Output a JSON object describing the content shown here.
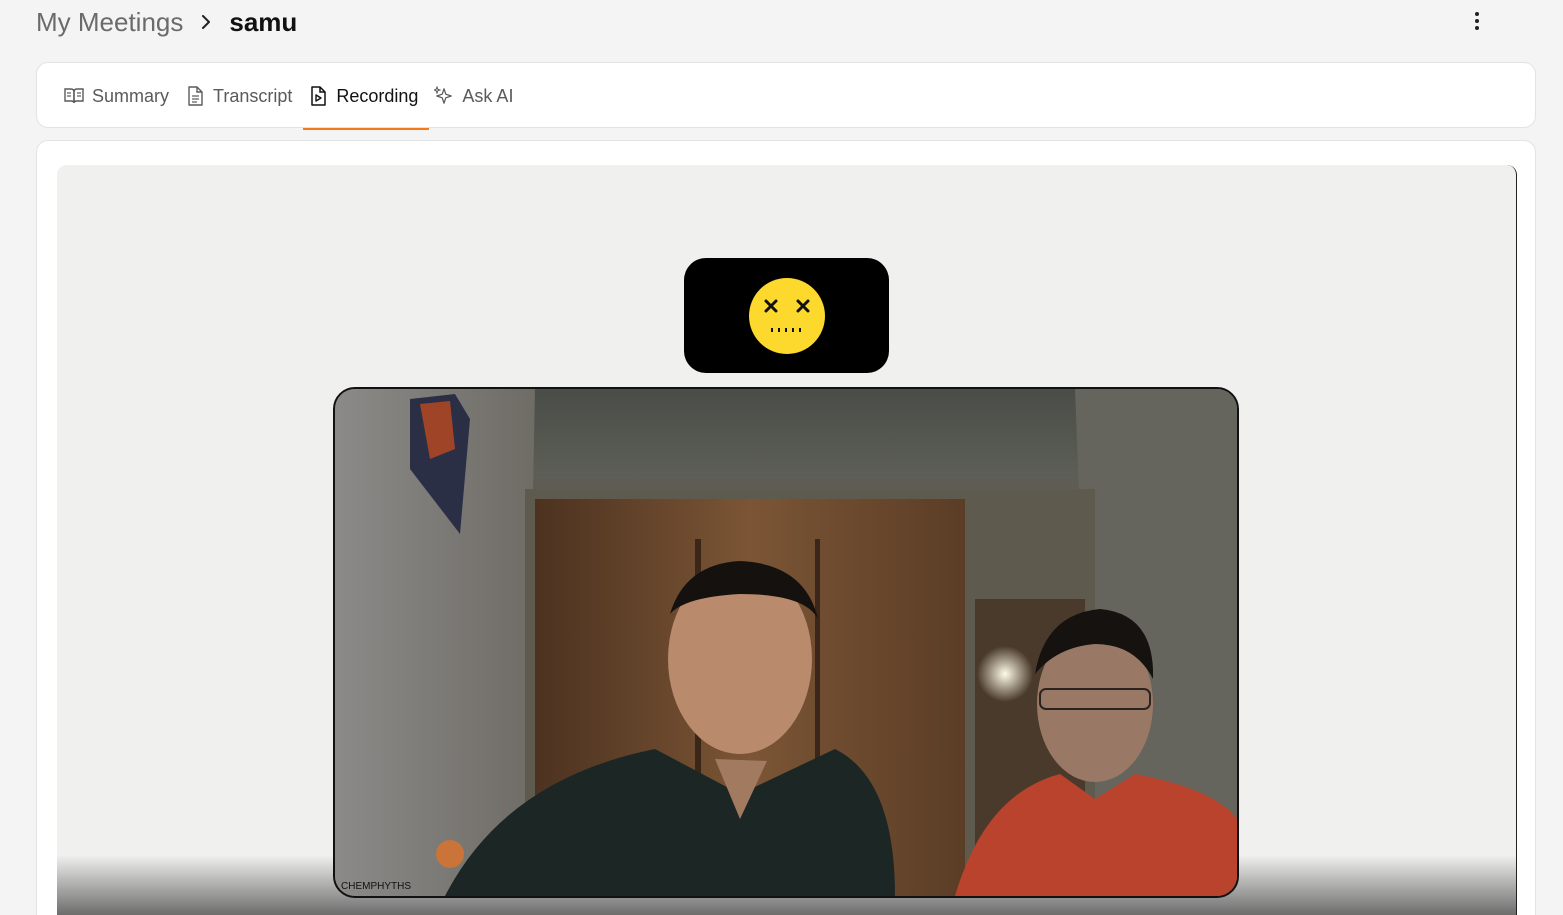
{
  "breadcrumb": {
    "root": "My Meetings",
    "current": "samu"
  },
  "tabs": [
    {
      "label": "Summary",
      "icon": "book-open-icon",
      "active": false
    },
    {
      "label": "Transcript",
      "icon": "document-icon",
      "active": false
    },
    {
      "label": "Recording",
      "icon": "file-play-icon",
      "active": true
    },
    {
      "label": "Ask AI",
      "icon": "sparkles-icon",
      "active": false
    }
  ],
  "recording": {
    "participant_label": "CHEMPHYTHS"
  },
  "colors": {
    "accent": "#f07a1c",
    "avatar_face": "#fcd92c"
  }
}
